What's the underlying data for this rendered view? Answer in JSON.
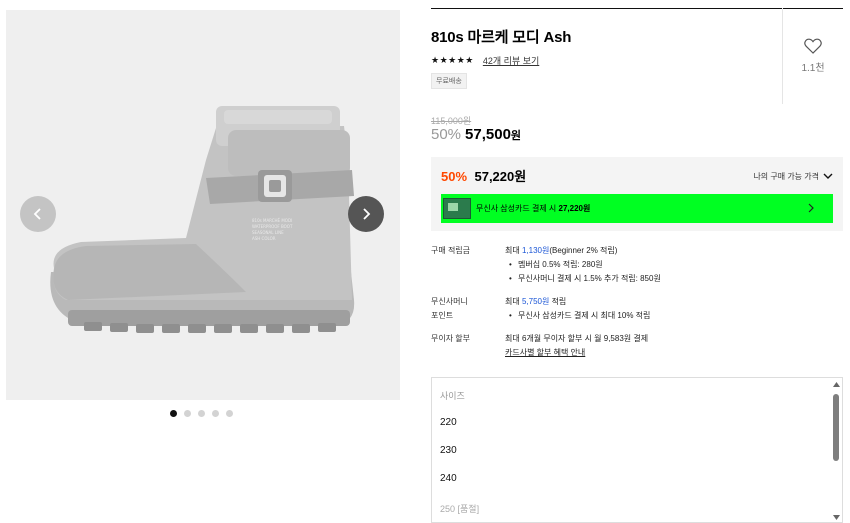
{
  "product": {
    "title": "810s 마르케 모디 Ash",
    "stars": "★★★★★",
    "review_link": "42개 리뷰 보기",
    "shipping_badge": "무료배송",
    "like_count": "1.1천",
    "original_price": "115,000원",
    "discount": "50%",
    "price": "57,500",
    "price_unit": "원"
  },
  "gallery": {
    "slide_count": 5,
    "active_slide": 1,
    "boot_print": [
      "810s MARCHÉ MODI",
      "WATERPROOF BOOT",
      "SEASONAL LINE",
      "ASH COLOR"
    ]
  },
  "my_price": {
    "discount": "50%",
    "price": "57,220원",
    "label": "나의 구매 가능 가격",
    "card_banner_prefix": "무신사 삼성카드 결제 시 ",
    "card_banner_price": "27,220원"
  },
  "benefits": {
    "points": {
      "label": "구매 적립금",
      "prefix": "최대 ",
      "amount": "1,130원",
      "suffix": "(Beginner 2% 적립)",
      "items": [
        "멤버십 0.5% 적립: 280원",
        "무신사머니 결제 시 1.5% 추가 적립: 850원"
      ]
    },
    "money": {
      "label_line1": "무신사머니",
      "label_line2": "포인트",
      "prefix": "최대 ",
      "amount": "5,750원",
      "suffix": " 적립",
      "items": [
        "무신사 삼성카드 결제 시 최대 10% 적립"
      ]
    },
    "installment": {
      "label": "무이자 할부",
      "text": "최대 6개월 무이자 할부 시 월 9,583원 결제",
      "link": "카드사별 할부 혜택 안내"
    }
  },
  "size_select": {
    "placeholder": "사이즈",
    "options": [
      "220",
      "230",
      "240"
    ],
    "disabled_option": "250 [품절]"
  },
  "colors": {
    "accent_orange": "#ff4800",
    "banner_green": "#00ff22",
    "link_blue": "#1a55d6"
  }
}
